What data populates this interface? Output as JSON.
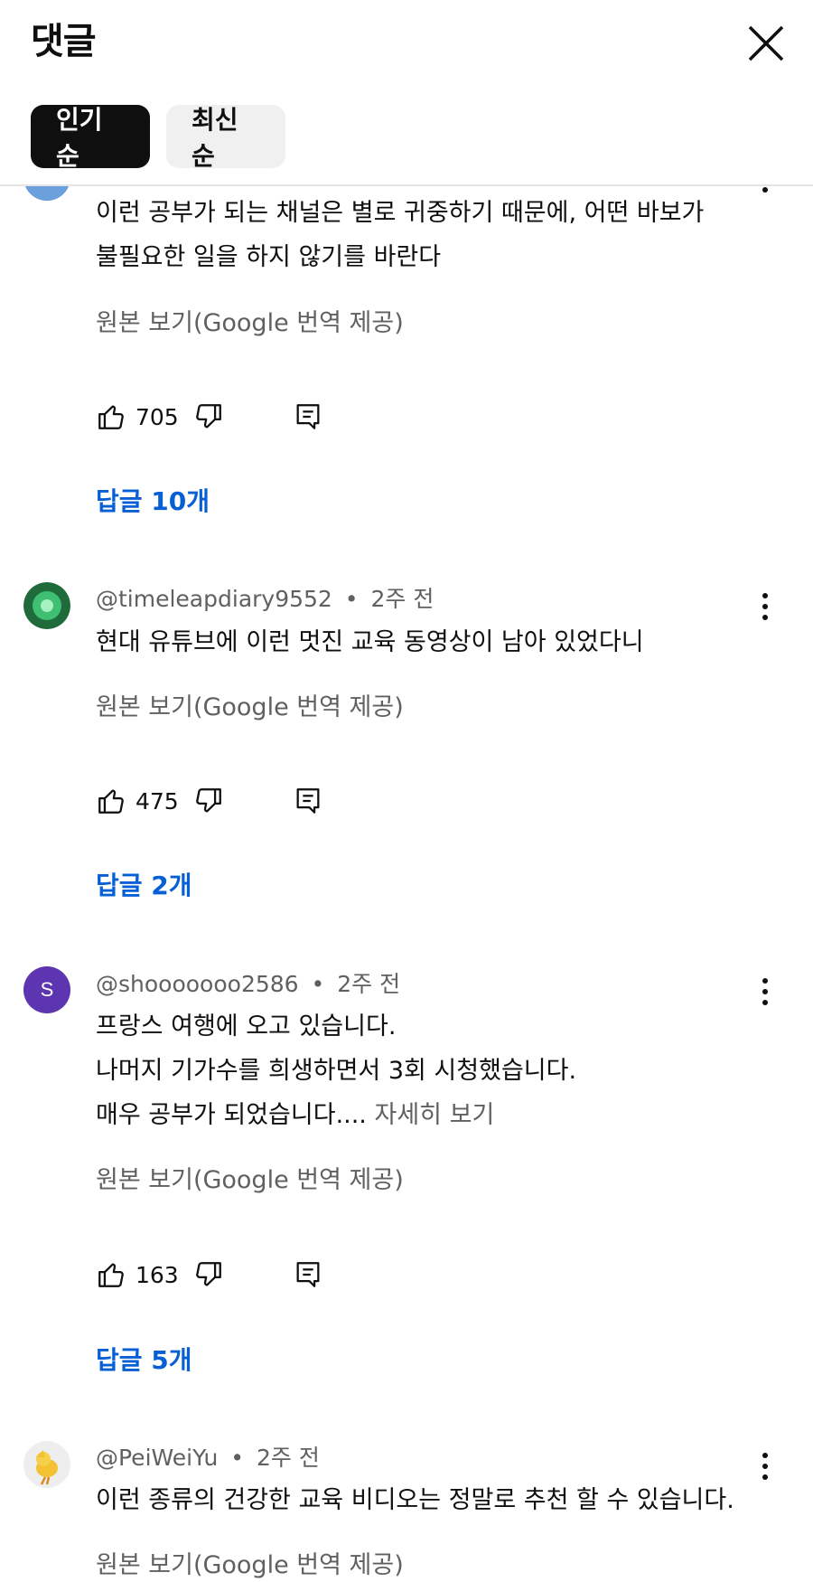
{
  "header": {
    "title": "댓글",
    "close_icon": "close-icon",
    "chips": [
      {
        "label": "인기순",
        "selected": true
      },
      {
        "label": "최신순",
        "selected": false
      }
    ]
  },
  "colors": {
    "reply_link": "#065fd4",
    "secondary_text": "#606060",
    "chip_active_bg": "#0f0f0f",
    "chip_inactive_bg": "#f0f0f0",
    "avatar_s": "#5e35b1"
  },
  "comments": [
    {
      "author": "",
      "time": "",
      "lines": [
        "이런 공부가 되는 채널은 별로 귀중하기 때문에, 어떤 바보가",
        "불필요한 일을 하지 않기를 바란다"
      ],
      "translate_label": "원본 보기(Google 번역 제공)",
      "likes": "705",
      "replies_label": "답글 10개"
    },
    {
      "author": "@timeleapdiary9552",
      "time": "2주 전",
      "lines": [
        "현대 유튜브에 이런 멋진 교육 동영상이 남아 있었다니"
      ],
      "translate_label": "원본 보기(Google 번역 제공)",
      "likes": "475",
      "replies_label": "답글 2개"
    },
    {
      "author": "@shooooooo2586",
      "time": "2주 전",
      "avatar_letter": "S",
      "lines": [
        "프랑스 여행에 오고 있습니다.",
        "나머지 기가수를 희생하면서 3회 시청했습니다.",
        "매우 공부가 되었습니다...."
      ],
      "read_more": "자세히 보기",
      "translate_label": "원본 보기(Google 번역 제공)",
      "likes": "163",
      "replies_label": "답글 5개"
    },
    {
      "author": "@PeiWeiYu",
      "time": "2주 전",
      "lines": [
        "이런 종류의 건강한 교육 비디오는 정말로 추천 할 수 있습니다."
      ],
      "translate_label": "원본 보기(Google 번역 제공)"
    }
  ],
  "dot_separator": "•"
}
